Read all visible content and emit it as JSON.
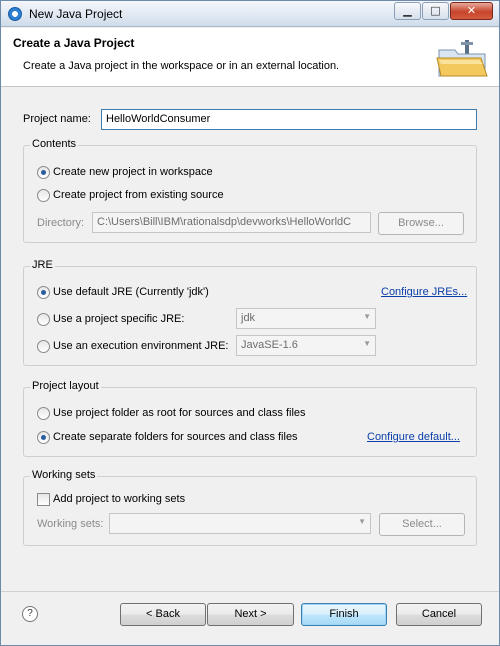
{
  "window": {
    "title": "New Java Project",
    "minimize_glyph": "▁",
    "maximize_glyph": "□",
    "close_glyph": "✕"
  },
  "header": {
    "title": "Create a Java Project",
    "description": "Create a Java project in the workspace or in an external location."
  },
  "project_name": {
    "label": "Project name:",
    "value": "HelloWorldConsumer"
  },
  "contents": {
    "title": "Contents",
    "option_new": "Create new project in workspace",
    "option_existing": "Create project from existing source",
    "directory_label": "Directory:",
    "directory_value": "C:\\Users\\Bill\\IBM\\rationalsdp\\devworks\\HelloWorldC",
    "browse_label": "Browse..."
  },
  "jre": {
    "title": "JRE",
    "option_default": "Use default JRE (Currently 'jdk')",
    "configure_link": "Configure JREs...",
    "option_specific": "Use a project specific JRE:",
    "specific_value": "jdk",
    "option_env": "Use an execution environment JRE:",
    "env_value": "JavaSE-1.6"
  },
  "project_layout": {
    "title": "Project layout",
    "option_root": "Use project folder as root for sources and class files",
    "option_separate": "Create separate folders for sources and class files",
    "configure_link": "Configure default..."
  },
  "working_sets": {
    "title": "Working sets",
    "add_label": "Add project to working sets",
    "sets_label": "Working sets:",
    "sets_value": "",
    "select_label": "Select..."
  },
  "footer": {
    "help_glyph": "?",
    "back_label": "< Back",
    "next_label": "Next >",
    "finish_label": "Finish",
    "cancel_label": "Cancel"
  },
  "state": {
    "contents_selected": "option_new",
    "jre_selected": "option_default",
    "layout_selected": "option_separate",
    "add_to_working_sets": false
  },
  "colors": {
    "link": "#0b3ea8",
    "radio_dot": "#2a5d9e",
    "default_button_border": "#3c7fb1"
  },
  "icons": {
    "title_icon": "eclipse-icon",
    "header_art": "folder-wizard-icon",
    "help": "help-icon",
    "dropdown": "chevron-down-icon"
  }
}
